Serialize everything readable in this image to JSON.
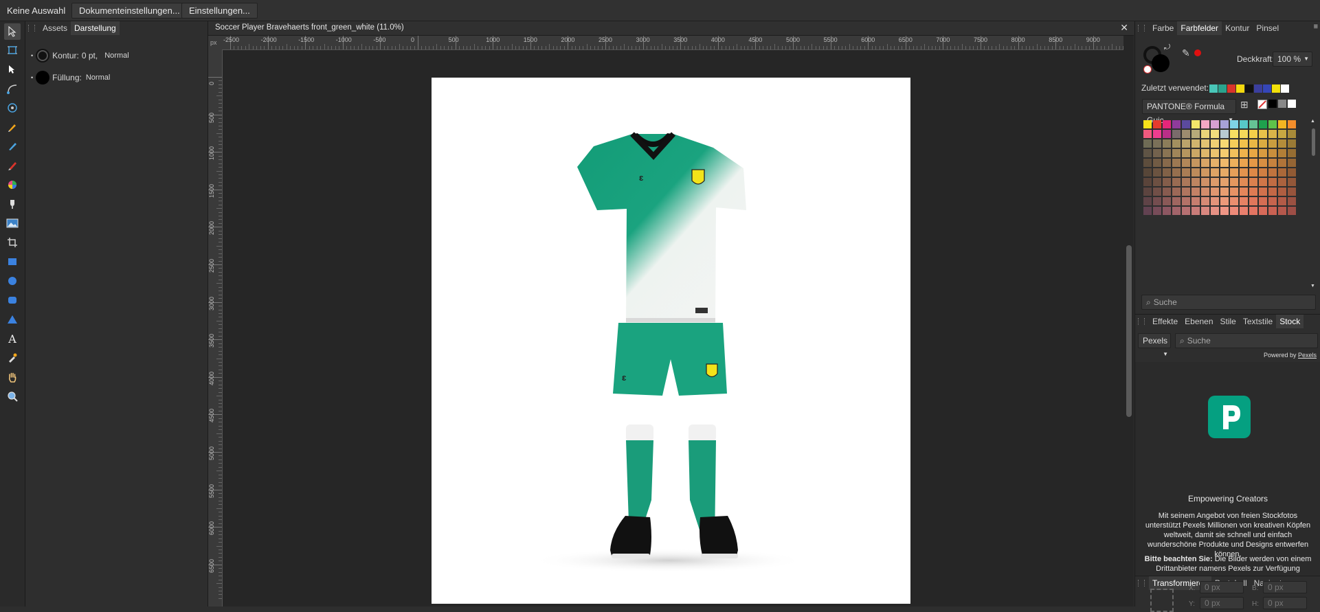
{
  "context_bar": {
    "selection": "Keine Auswahl",
    "doc_settings_button": "Dokumenteinstellungen...",
    "settings_button": "Einstellungen..."
  },
  "left_panel": {
    "tabs": [
      "Assets",
      "Darstellung"
    ],
    "active_tab": "Darstellung",
    "stroke_label": "Kontur:",
    "stroke_value": "0 pt,",
    "stroke_blend": "Normal",
    "fill_label": "Füllung:",
    "fill_blend": "Normal"
  },
  "document": {
    "title": "Soccer Player Bravehaerts front_green_white (11.0%)",
    "ruler_unit": "px",
    "h_ticks": [
      "-2500",
      "-2000",
      "-1500",
      "-1000",
      "-500",
      "0",
      "500",
      "1000",
      "1500",
      "2000",
      "2500",
      "3000",
      "3500",
      "4000",
      "4500",
      "5000",
      "5500",
      "6000",
      "6500",
      "7000",
      "7500",
      "8000",
      "8500",
      "9000"
    ],
    "v_ticks": [
      "0",
      "500",
      "1000",
      "1500",
      "2000",
      "2500",
      "3000",
      "3500",
      "4000",
      "4500",
      "5000",
      "5500",
      "6000",
      "6500"
    ]
  },
  "swatches_panel": {
    "tabs": [
      "Farbe",
      "Farbfelder",
      "Kontur",
      "Pinsel"
    ],
    "active_tab": "Farbfelder",
    "opacity_label": "Deckkraft:",
    "opacity_value": "100 %",
    "recent_label": "Zuletzt verwendet:",
    "recent_colors": [
      "#49c6b8",
      "#2aa38d",
      "#d9342b",
      "#f4d90f",
      "#111111",
      "#3b3f9e",
      "#3546b8",
      "#f2e00a",
      "#ffffff"
    ],
    "palette_name": "PANTONE® Formula Guic",
    "search_placeholder": "Suche",
    "grid_colors": [
      "#f7e21a",
      "#e63b2e",
      "#e5267a",
      "#8f3b9b",
      "#5b4a9f",
      "#f4e76a",
      "#f6a8c3",
      "#d6a0d0",
      "#a7a1d7",
      "#7fd2e6",
      "#57c8c8",
      "#65c295",
      "#1ea14d",
      "#5fc24a",
      "#f3b522",
      "#f48e2b",
      "#ef5a7e",
      "#ee3d8f",
      "#ba2f88",
      "#7a6b6b",
      "#9d8c6f",
      "#b7aa7a",
      "#e9d37a",
      "#f2dd7d",
      "#b7c9d1",
      "#f7df62",
      "#f5d95a",
      "#f4cf4a",
      "#e8c24a",
      "#d9b449",
      "#c7a842",
      "#a88b39",
      "#6e6b55",
      "#7a7059",
      "#8c7d5a",
      "#a28f5f",
      "#bba36b",
      "#d0b46e",
      "#e3c373",
      "#f0cf74",
      "#f6d873",
      "#f5cd5a",
      "#f2c14c",
      "#eab745",
      "#dbab41",
      "#c99d3f",
      "#b48d3a",
      "#9a7a35",
      "#5f5445",
      "#73624d",
      "#8a7453",
      "#a08559",
      "#b6965f",
      "#cba765",
      "#deb76b",
      "#ecc36f",
      "#f4cb6f",
      "#f2c05c",
      "#efb24c",
      "#e8a744",
      "#d99b40",
      "#c88e3c",
      "#b27f37",
      "#966d32",
      "#5d4d3c",
      "#715b44",
      "#87694b",
      "#9c7852",
      "#b18759",
      "#c5965f",
      "#d8a566",
      "#e6b16a",
      "#efb96b",
      "#eeb05c",
      "#eba44f",
      "#e59847",
      "#d78e42",
      "#c6823e",
      "#b07439",
      "#956534",
      "#574638",
      "#6b5340",
      "#816147",
      "#966f4e",
      "#aa7d55",
      "#bd8b5b",
      "#cf9861",
      "#dda365",
      "#e6aa66",
      "#e69f59",
      "#e3934e",
      "#dd8847",
      "#d07e42",
      "#c0733e",
      "#ab6839",
      "#915a34",
      "#5a443a",
      "#6d5042",
      "#845d4a",
      "#996b52",
      "#ac785a",
      "#be8561",
      "#cf9167",
      "#dc9b6b",
      "#e4a16c",
      "#e4975f",
      "#e18b55",
      "#db804e",
      "#cf7648",
      "#c06c43",
      "#ab623e",
      "#935739",
      "#5c443f",
      "#714f47",
      "#875b4f",
      "#9c6857",
      "#b0755f",
      "#c38166",
      "#d38d6c",
      "#e09770",
      "#e89d71",
      "#e79265",
      "#e4865b",
      "#de7b53",
      "#d2714c",
      "#c36846",
      "#af5e41",
      "#97543c",
      "#5f4347",
      "#744d4f",
      "#8a5957",
      "#9f6660",
      "#b37268",
      "#c67e6f",
      "#d68a75",
      "#e3947a",
      "#eb997a",
      "#ea8e6f",
      "#e68264",
      "#e0775b",
      "#d56d53",
      "#c6644d",
      "#b25b47",
      "#9a5142",
      "#624251",
      "#774c59",
      "#8d5762",
      "#a2646a",
      "#b67072",
      "#c97c79",
      "#d9877f",
      "#e69184",
      "#ee9585",
      "#ed8a79",
      "#e97f6d",
      "#e37462",
      "#d86a59",
      "#c96152",
      "#b5584c",
      "#9d4e46"
    ]
  },
  "stock_panel": {
    "tabs": [
      "Effekte",
      "Ebenen",
      "Stile",
      "Textstile",
      "Stock"
    ],
    "active_tab": "Stock",
    "provider": "Pexels",
    "search_placeholder": "Suche",
    "powered_by": "Powered by",
    "powered_link": "Pexels",
    "heading": "Empowering Creators",
    "paragraph1": "Mit seinem Angebot von freien Stockfotos unterstützt Pexels Millionen von kreativen Köpfen weltweit, damit sie schnell und einfach wunderschöne Produkte und Designs entwerfen können.",
    "note_bold": "Bitte beachten Sie:",
    "note_text": " Die Bilder werden von einem Drittanbieter namens Pexels zur Verfügung gestellt; sie werden nicht von Serif zur Verfügung gestellt."
  },
  "transform_panel": {
    "tabs": [
      "Transformieren",
      "Protokoll",
      "Navigator"
    ],
    "active_tab": "Transformieren",
    "x_label": "X:",
    "x_value": "0 px",
    "w_label": "B:",
    "w_value": "0 px",
    "y_label": "Y:",
    "y_value": "0 px",
    "h_label": "H:",
    "h_value": "0 px"
  },
  "colors": {
    "jersey_green": "#1aa37f",
    "sock_green": "#1a9c7a",
    "crest_yellow": "#f2e31a",
    "pexels_green": "#05a081",
    "active_tab_bg": "#3c3c3c"
  }
}
